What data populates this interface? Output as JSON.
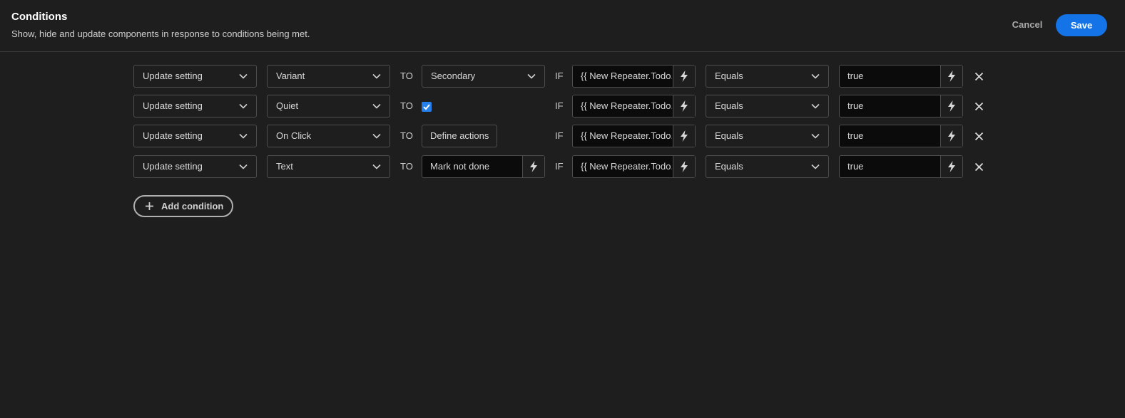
{
  "header": {
    "title": "Conditions",
    "subtitle": "Show, hide and update components in response to conditions being met.",
    "cancel_label": "Cancel",
    "save_label": "Save"
  },
  "labels": {
    "to": "TO",
    "if": "IF"
  },
  "rows": [
    {
      "action": "Update setting",
      "setting": "Variant",
      "value_type": "select",
      "value": "Secondary",
      "condition": "{{ New Repeater.Todo.Done }}",
      "operator": "Equals",
      "reference": "true"
    },
    {
      "action": "Update setting",
      "setting": "Quiet",
      "value_type": "checkbox",
      "value": "checked",
      "condition": "{{ New Repeater.Todo.Done }}",
      "operator": "Equals",
      "reference": "true"
    },
    {
      "action": "Update setting",
      "setting": "On Click",
      "value_type": "button",
      "value": "Define actions",
      "condition": "{{ New Repeater.Todo.Done }}",
      "operator": "Equals",
      "reference": "true"
    },
    {
      "action": "Update setting",
      "setting": "Text",
      "value_type": "binding",
      "value": "Mark not done",
      "condition": "{{ New Repeater.Todo.Done }}",
      "operator": "Equals",
      "reference": "true"
    }
  ],
  "add_condition_label": "Add condition",
  "colors": {
    "accent": "#1473e6",
    "background": "#1e1e1e",
    "checkbox": "#2680eb"
  }
}
